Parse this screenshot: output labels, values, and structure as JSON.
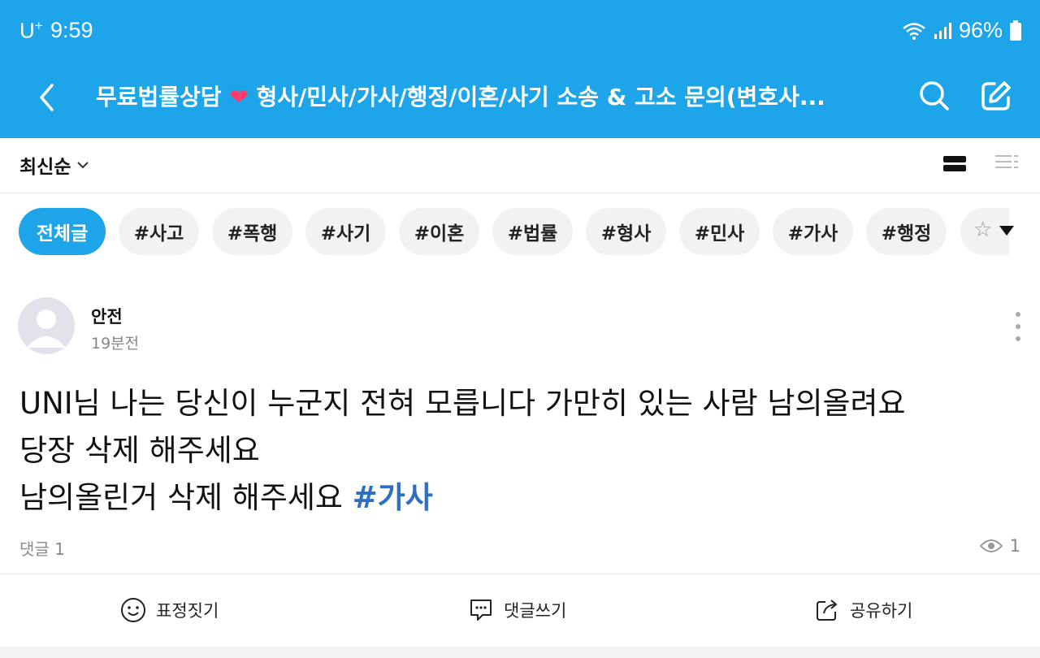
{
  "status_bar": {
    "carrier": "U",
    "carrier_sup": "+",
    "time": "9:59",
    "battery": "96%"
  },
  "nav": {
    "title_part1": "무료법률상담",
    "title_emoji": "❤",
    "title_part2": " 형사/민사/가사/행정/이혼/사기 소송 & 고소 문의(변호사..."
  },
  "sort": {
    "label": "최신순"
  },
  "tags": [
    {
      "label": "전체글",
      "active": true
    },
    {
      "label": "#사고"
    },
    {
      "label": "#폭행"
    },
    {
      "label": "#사기"
    },
    {
      "label": "#이혼"
    },
    {
      "label": "#법률"
    },
    {
      "label": "#형사"
    },
    {
      "label": "#민사"
    },
    {
      "label": "#가사"
    },
    {
      "label": "#행정"
    }
  ],
  "post": {
    "author": "안전",
    "time": "19분전",
    "line1": "UNI님 나는 당신이 누군지 전혀 모릅니다 가만히 있는 사람 남의올려요",
    "line2": "당장 삭제 해주세요",
    "line3": "남의올린거 삭제 해주세요 ",
    "hashtag": "#가사",
    "comments": "댓글 1",
    "views": "1"
  },
  "actions": {
    "react": "표정짓기",
    "comment": "댓글쓰기",
    "share": "공유하기"
  },
  "colors": {
    "brand": "#1ea4e9",
    "hashtag": "#2f6fc2",
    "chip_bg": "#f2f2f4"
  }
}
